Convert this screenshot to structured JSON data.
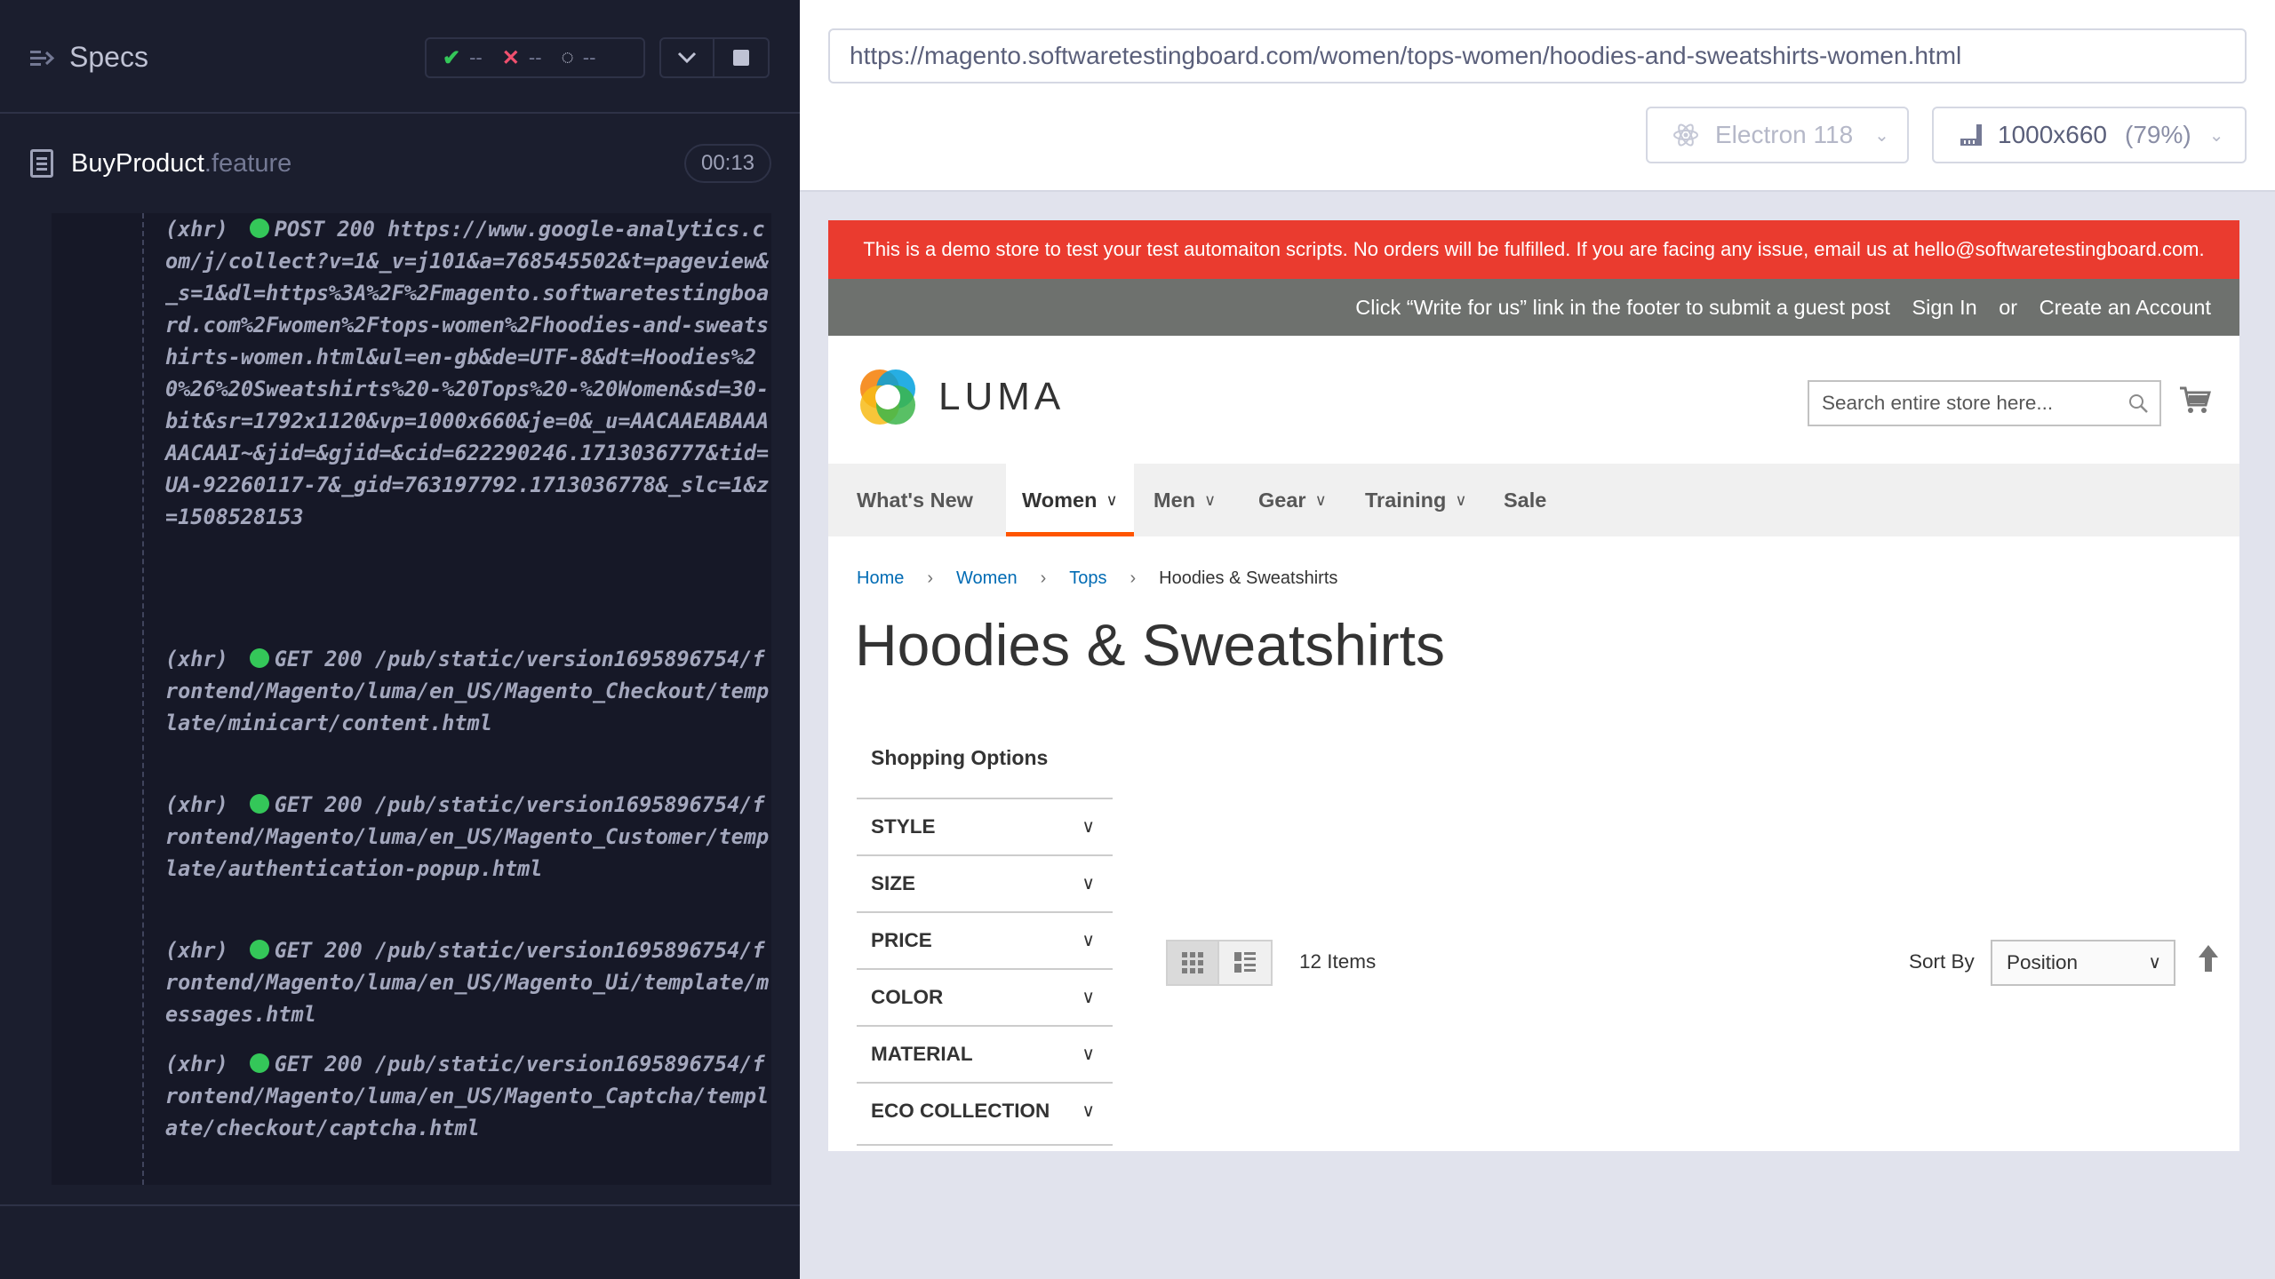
{
  "runner": {
    "specs_title": "Specs",
    "stats": {
      "passed": "--",
      "failed": "--",
      "pending": "--"
    },
    "feature": {
      "name": "BuyProduct",
      "ext": ".feature"
    },
    "timer": "00:13",
    "log": [
      {
        "type": "(xhr)",
        "method": "POST 200",
        "url": "https://www.google-analytics.com/j/collect?v=1&_v=j101&a=768545502&t=pageview&_s=1&dl=https%3A%2F%2Fmagento.softwaretestingboard.com%2Fwomen%2Ftops-women%2Fhoodies-and-sweatshirts-women.html&ul=en-gb&de=UTF-8&dt=Hoodies%20%26%20Sweatshirts%20-%20Tops%20-%20Women&sd=30-bit&sr=1792x1120&vp=1000x660&je=0&_u=AACAAEABAAAAACAAI~&jid=&gjid=&cid=622290246.1713036777&tid=UA-92260117-7&_gid=763197792.1713036778&_slc=1&z=1508528153"
      },
      {
        "type": "(xhr)",
        "method": "GET 200",
        "url": "/pub/static/version1695896754/frontend/Magento/luma/en_US/Magento_Checkout/template/minicart/content.html"
      },
      {
        "type": "(xhr)",
        "method": "GET 200",
        "url": "/pub/static/version1695896754/frontend/Magento/luma/en_US/Magento_Customer/template/authentication-popup.html"
      },
      {
        "type": "(xhr)",
        "method": "GET 200",
        "url": "/pub/static/version1695896754/frontend/Magento/luma/en_US/Magento_Ui/template/messages.html"
      },
      {
        "type": "(xhr)",
        "method": "GET 200",
        "url": "/pub/static/version1695896754/frontend/Magento/luma/en_US/Magento_Captcha/template/checkout/captcha.html"
      }
    ]
  },
  "browser": {
    "url": "https://magento.softwaretestingboard.com/women/tops-women/hoodies-and-sweatshirts-women.html",
    "engine": "Electron 118",
    "viewport": "1000x660",
    "zoom": "(79%)"
  },
  "store": {
    "demo_notice": "This is a demo store to test your test automaiton scripts. No orders will be fulfilled. If you are facing any issue, email us at hello@softwaretestingboard.com.",
    "panel": {
      "guest_post": "Click “Write for us” link in the footer to submit a guest post",
      "sign_in": "Sign In",
      "or": "or",
      "create_account": "Create an Account"
    },
    "logo_text": "LUMA",
    "search_placeholder": "Search entire store here...",
    "nav": [
      "What's New",
      "Women",
      "Men",
      "Gear",
      "Training",
      "Sale"
    ],
    "breadcrumbs": [
      "Home",
      "Women",
      "Tops",
      "Hoodies & Sweatshirts"
    ],
    "page_title": "Hoodies & Sweatshirts",
    "shopping_options": "Shopping Options",
    "filters": [
      "STYLE",
      "SIZE",
      "PRICE",
      "COLOR",
      "MATERIAL",
      "ECO COLLECTION"
    ],
    "items_count": "12 Items",
    "sort_label": "Sort By",
    "sort_value": "Position"
  },
  "colors": {
    "demo_banner": "#ea3b2f",
    "panel_bar": "#6e716e",
    "nav_active": "#ff5501",
    "link": "#006bb4",
    "pass": "#34c759",
    "fail": "#f0506e"
  }
}
